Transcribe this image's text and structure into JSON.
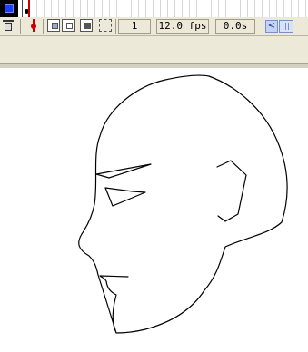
{
  "timeline": {
    "layer_color": "#1f3cff",
    "current_frame": 1
  },
  "toolbar": {
    "icons": [
      "trash-icon",
      "playhead-icon",
      "onion-skin-icon",
      "onion-skin-outlines-icon",
      "edit-multiple-frames-icon",
      "modify-onion-markers-icon"
    ],
    "frame_value": "1",
    "fps_value": "12.0 fps",
    "time_value": "0.0s",
    "scroll_left_glyph": "<"
  },
  "stage": {
    "content": "head-profile-line-drawing",
    "stroke_color": "#000000"
  }
}
